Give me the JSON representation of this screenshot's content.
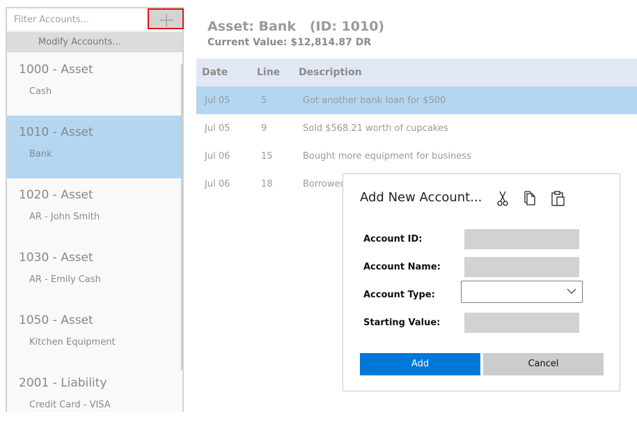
{
  "sidebar": {
    "filter_placeholder": "Filter Accounts...",
    "modify_label": "Modify Accounts...",
    "add_icon": "plus-icon",
    "accounts": [
      {
        "title": "1000 - Asset",
        "name": "Cash",
        "selected": false
      },
      {
        "title": "1010 - Asset",
        "name": "Bank",
        "selected": true
      },
      {
        "title": "1020 - Asset",
        "name": "AR - John Smith",
        "selected": false
      },
      {
        "title": "1030 - Asset",
        "name": "AR - Emily Cash",
        "selected": false
      },
      {
        "title": "1050 - Asset",
        "name": "Kitchen Equipment",
        "selected": false
      },
      {
        "title": "2001 - Liability",
        "name": "Credit Card - VISA",
        "selected": false
      }
    ]
  },
  "header": {
    "title": "Asset: Bank   (ID: 1010)",
    "current_value": "Current Value: $12,814.87 DR"
  },
  "ledger": {
    "columns": [
      "Date",
      "Line",
      "Description"
    ],
    "rows": [
      {
        "date": "Jul 05",
        "line": "5",
        "description": "Got another bank loan for $500",
        "selected": true
      },
      {
        "date": "Jul 05",
        "line": "9",
        "description": "Sold $568.21 worth of cupcakes",
        "selected": false
      },
      {
        "date": "Jul 06",
        "line": "15",
        "description": "Bought more equipment for business",
        "selected": false
      },
      {
        "date": "Jul 06",
        "line": "18",
        "description": "Borrowed",
        "selected": false
      }
    ]
  },
  "dialog": {
    "title": "Add New Account...",
    "icons": [
      "cut-icon",
      "copy-icon",
      "paste-icon"
    ],
    "fields": {
      "account_id_label": "Account ID:",
      "account_id_value": "",
      "account_name_label": "Account Name:",
      "account_name_value": "",
      "account_type_label": "Account Type:",
      "account_type_value": "",
      "starting_value_label": "Starting Value:",
      "starting_value_value": ""
    },
    "add_label": "Add",
    "cancel_label": "Cancel"
  },
  "colors": {
    "selection": "#b4d6f1",
    "primary_button": "#0078d7",
    "highlight_border": "#e0121e"
  }
}
